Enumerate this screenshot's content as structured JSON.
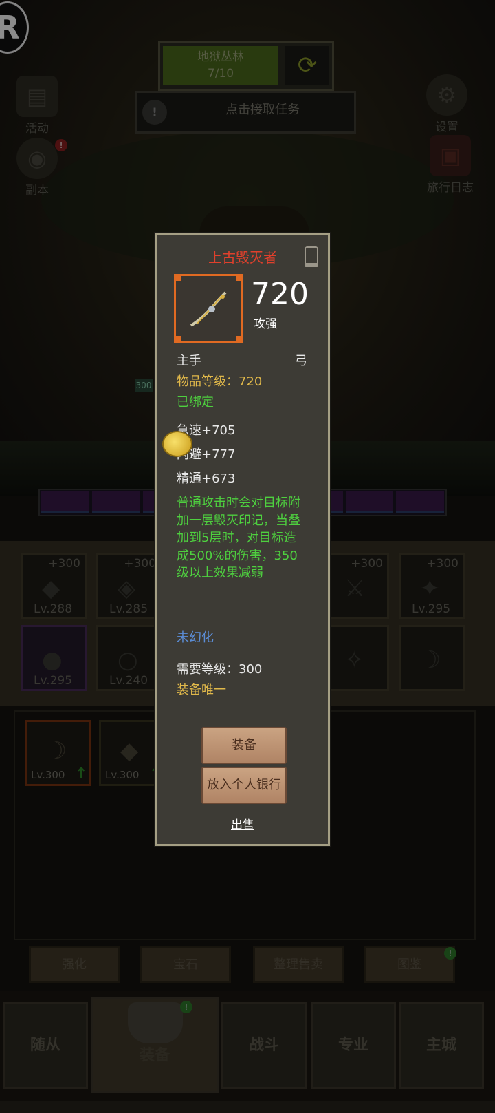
{
  "hud": {
    "logo": "R",
    "stage_name": "地狱丛林",
    "stage_progress": "7/10",
    "task_label": "点击接取任务",
    "task_icon_text": "!",
    "left_icons": [
      {
        "label": "活动",
        "icon": "scroll-icon"
      },
      {
        "label": "副本",
        "icon": "portal-icon",
        "badge": "!"
      }
    ],
    "right_icons": [
      {
        "label": "设置",
        "icon": "gear-icon"
      },
      {
        "label": "旅行日志",
        "icon": "book-icon"
      }
    ],
    "hp_label": "300"
  },
  "equipment_slots": [
    {
      "plus": "+300",
      "lv": "Lv.288"
    },
    {
      "plus": "+300",
      "lv": "Lv.285"
    },
    {
      "plus": "+300",
      "lv": ""
    },
    {
      "plus": "+300",
      "lv": "Lv.295"
    },
    {
      "plus": "",
      "lv": "Lv.295"
    },
    {
      "plus": "",
      "lv": "Lv.240"
    }
  ],
  "bag_items": [
    {
      "lv": "Lv.300"
    },
    {
      "lv": "Lv.300"
    }
  ],
  "actions": [
    "强化",
    "宝石",
    "整理售卖",
    "图鉴"
  ],
  "nav": [
    "随从",
    "装备",
    "战斗",
    "专业",
    "主城"
  ],
  "popup": {
    "title": "上古毁灭者",
    "power": "720",
    "power_label": "攻强",
    "slot": "主手",
    "weapon_type": "弓",
    "item_level": "物品等级：720",
    "bound": "已绑定",
    "stats": [
      "急速+705",
      "闪避+777",
      "精通+673"
    ],
    "effect": "普通攻击时会对目标附加一层毁灭印记，当叠加到5层时，对目标造成500%的伤害，350级以上效果减弱",
    "transmog": "未幻化",
    "required_level": "需要等级：300",
    "unique": "装备唯一",
    "btn_equip": "装备",
    "btn_bank": "放入个人银行",
    "btn_sell": "出售"
  },
  "colors": {
    "title_red": "#e0402c",
    "stat_yellow": "#e0b84a",
    "effect_green": "#4ed03f",
    "transmog_blue": "#5c8ed8",
    "item_border_orange": "#e06a22"
  }
}
